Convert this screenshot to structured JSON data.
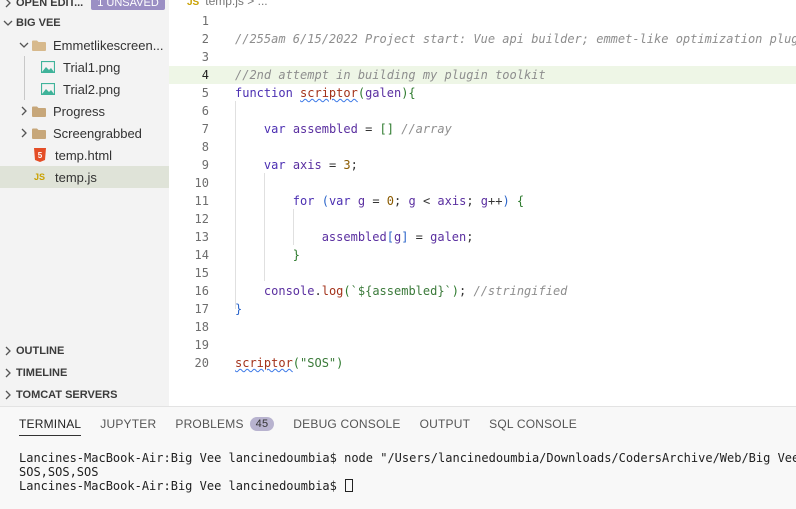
{
  "sidebar": {
    "open_editors_label": "OPEN EDIT...",
    "unsaved_badge": "1 UNSAVED",
    "project_label": "BIG VEE",
    "items": [
      {
        "label": "Emmetlikescreen..."
      },
      {
        "label": "Trial1.png"
      },
      {
        "label": "Trial2.png"
      },
      {
        "label": "Progress"
      },
      {
        "label": "Screengrabbed"
      },
      {
        "label": "temp.html"
      },
      {
        "label": "temp.js"
      }
    ],
    "outline_label": "OUTLINE",
    "timeline_label": "TIMELINE",
    "tomcat_label": "TOMCAT SERVERS"
  },
  "editor": {
    "breadcrumb_file": "temp.js",
    "breadcrumb_rest": "> ...",
    "line_numbers": [
      "1",
      "2",
      "3",
      "4",
      "5",
      "6",
      "7",
      "8",
      "9",
      "10",
      "11",
      "12",
      "13",
      "14",
      "15",
      "16",
      "17",
      "18",
      "19",
      "20"
    ],
    "comment_line2": "//255am 6/15/2022 Project start: Vue api builder; emmet-like optimization plug",
    "comment_line4": "//2nd attempt in building my plugin toolkit",
    "kw_function": "function",
    "fn_scriptor": "scriptor",
    "param_galen": "galen",
    "kw_var": "var",
    "id_assembled": "assembled",
    "comment_array": "//array",
    "id_axis": "axis",
    "num_three": "3",
    "kw_for": "for",
    "id_g": "g",
    "num_zero": "0",
    "id_console": "console",
    "fn_log": "log",
    "tpl_string": "`${assembled}`",
    "comment_stringified": "//stringified",
    "str_sos": "\"SOS\""
  },
  "panel": {
    "tabs": [
      {
        "label": "TERMINAL"
      },
      {
        "label": "JUPYTER"
      },
      {
        "label": "PROBLEMS",
        "count": "45"
      },
      {
        "label": "DEBUG CONSOLE"
      },
      {
        "label": "OUTPUT"
      },
      {
        "label": "SQL CONSOLE"
      }
    ],
    "terminal_lines": [
      "Lancines-MacBook-Air:Big Vee lancinedoumbia$ node \"/Users/lancinedoumbia/Downloads/CodersArchive/Web/Big Vee/te",
      "SOS,SOS,SOS",
      "Lancines-MacBook-Air:Big Vee lancinedoumbia$ "
    ]
  },
  "colors": {
    "badge": "#9b8fc4",
    "selected_row": "#dfe3d8",
    "current_line": "#eef6e6"
  }
}
